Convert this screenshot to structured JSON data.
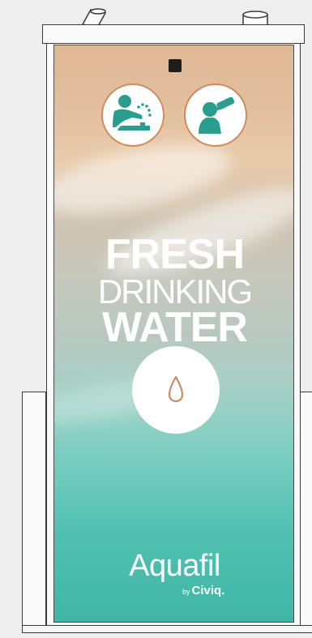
{
  "sign": {
    "headline_line1": "FRESH",
    "headline_line2": "DRINKING",
    "headline_line3": "WATER",
    "brand_name": "Aquafil",
    "brand_by": "by",
    "brand_company": "Civiq."
  },
  "icons": {
    "fountain": "drinking-fountain-icon",
    "bottle": "bottle-refill-icon",
    "drop": "water-drop-icon"
  },
  "colors": {
    "icon_teal": "#2a9d8f",
    "icon_ring": "#d08a5c",
    "headline": "#ffffff"
  }
}
